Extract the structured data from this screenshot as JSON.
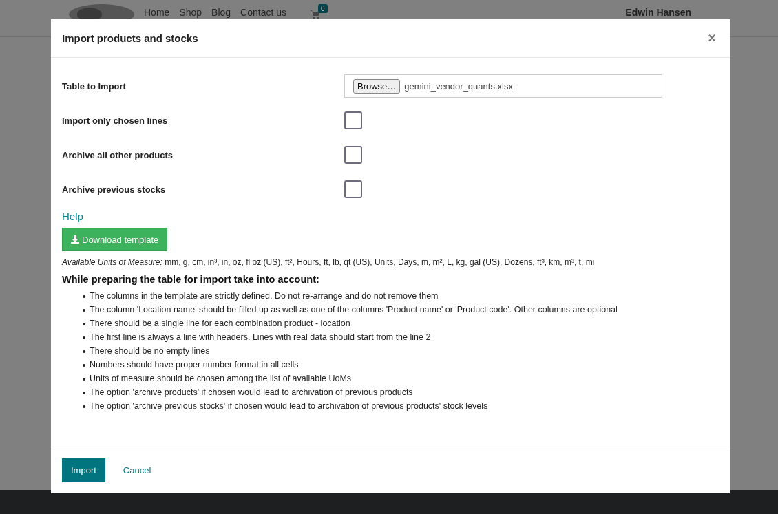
{
  "navbar": {
    "links": [
      "Home",
      "Shop",
      "Blog",
      "Contact us"
    ],
    "cart_count": "0",
    "user": "Edwin Hansen"
  },
  "dialog": {
    "title": "Import products and stocks",
    "close": "×",
    "fields": [
      {
        "kind": "file",
        "label": "Table to Import",
        "button": "Browse…",
        "value": "gemini_vendor_quants.xlsx"
      },
      {
        "kind": "checkbox",
        "label": "Import only chosen lines",
        "checked": false
      },
      {
        "kind": "checkbox",
        "label": "Archive all other products",
        "checked": false
      },
      {
        "kind": "checkbox",
        "label": "Archive previous stocks",
        "checked": false
      }
    ],
    "help": {
      "title": "Help",
      "download_button": "Download template",
      "units": "*Available Units of Measure:* mm, g, cm, in³, in, oz, fl oz (US), ft², Hours, ft, lb, qt (US), Units, Days, m, m², L, kg, gal (US), Dozens, ft³, km, m³, t, mi",
      "heading": "While preparing the table for import take into account:",
      "rules": [
        "The columns in the template are strictly defined. Do not re-arrange and do not remove them",
        "The column 'Location name' should be filled up as well as one of the columns 'Product name' or 'Product code'. Other columns are optional",
        "There should be a single line for each combination product - location",
        "The first line is always a line with headers. Lines with real data should start from the line 2",
        "There should be no empty lines",
        "Numbers should have proper number format in all cells",
        "Units of measure should be chosen among the list of available UoMs",
        "The option 'archive products' if chosen would lead to archivation of previous products",
        "The option 'archive previous stocks' if chosen would lead to archivation of previous products' stock levels"
      ]
    },
    "buttons": [
      "Import",
      "Cancel"
    ]
  }
}
